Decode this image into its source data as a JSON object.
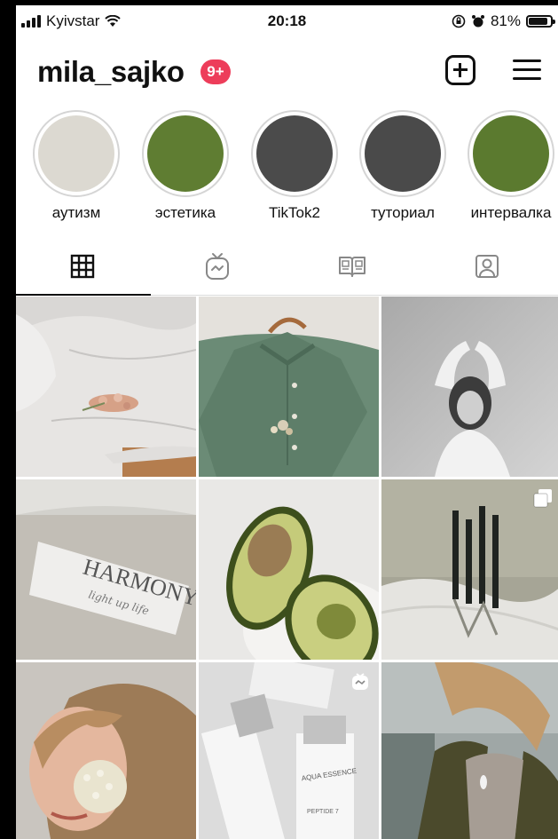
{
  "status_bar": {
    "carrier": "Kyivstar",
    "time": "20:18",
    "battery": "81%"
  },
  "header": {
    "username": "mila_sajko",
    "badge": "9+"
  },
  "highlights": [
    {
      "label": "аутизм",
      "color": "#dcd9d1"
    },
    {
      "label": "эстетика",
      "color": "#5f7d32"
    },
    {
      "label": "TikTok2",
      "color": "#4b4b4b"
    },
    {
      "label": "туториал",
      "color": "#4a4a4a"
    },
    {
      "label": "интервалка",
      "color": "#5b7a2f"
    }
  ],
  "tabs": [
    {
      "name": "grid-tab",
      "icon": "grid-icon",
      "active": true
    },
    {
      "name": "igtv-tab",
      "icon": "igtv-icon",
      "active": false
    },
    {
      "name": "guides-tab",
      "icon": "guides-icon",
      "active": false
    },
    {
      "name": "tagged-tab",
      "icon": "tagged-person-icon",
      "active": false
    }
  ],
  "posts": [
    {
      "name": "post-bed-flowers",
      "badge": ""
    },
    {
      "name": "post-green-shirt",
      "badge": ""
    },
    {
      "name": "post-bw-portrait",
      "badge": ""
    },
    {
      "name": "post-harmony-candle",
      "text1": "HARMONY",
      "text2": "light up life",
      "badge": ""
    },
    {
      "name": "post-avocado",
      "badge": ""
    },
    {
      "name": "post-black-candles",
      "badge": "carousel-icon"
    },
    {
      "name": "post-girl-flowers",
      "badge": ""
    },
    {
      "name": "post-aqua-essence",
      "text1": "AQUA ESSENCE",
      "text2": "PEPTIDE 7",
      "badge": "igtv-icon"
    },
    {
      "name": "post-girl-jacket",
      "badge": ""
    }
  ]
}
